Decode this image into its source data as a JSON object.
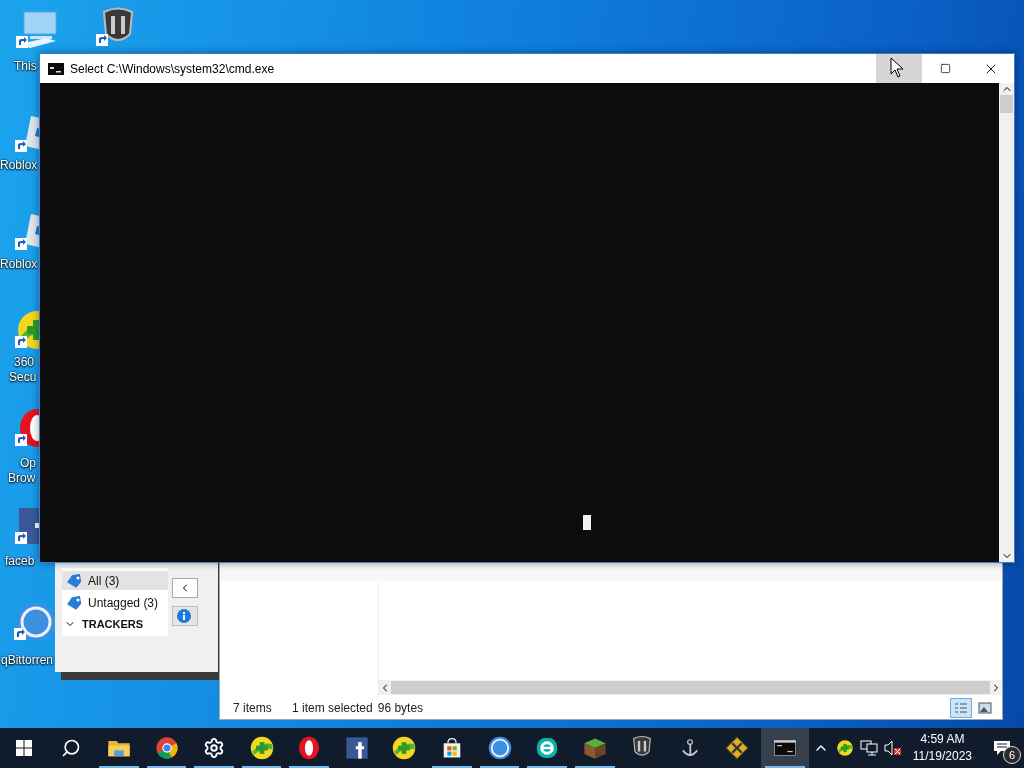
{
  "desktop_icons": [
    {
      "kind": "pc",
      "label_lines": [
        "This"
      ]
    },
    {
      "kind": "tanks"
    },
    {
      "kind": "roblox",
      "label_lines": [
        "Roblox"
      ]
    },
    {
      "kind": "roblox",
      "label_lines": [
        "Roblox"
      ]
    },
    {
      "kind": "security360",
      "label_lines": [
        "360",
        "Secu"
      ]
    },
    {
      "kind": "opera",
      "label_lines": [
        "Op",
        "Brow"
      ]
    },
    {
      "kind": "facebook",
      "label_lines": [
        "faceb"
      ]
    },
    {
      "kind": "qbittorrent",
      "label_lines": [
        "qBittorren"
      ]
    }
  ],
  "qbittorrent_window": {
    "tags": [
      {
        "label": "All (3)",
        "selected": true
      },
      {
        "label": "Untagged (3)",
        "selected": false
      }
    ],
    "section": "TRACKERS"
  },
  "explorer_window": {
    "item_count": "7 items",
    "selection": "1 item selected",
    "size": "96 bytes",
    "views": [
      {
        "kind": "details",
        "selected": true
      },
      {
        "kind": "large",
        "selected": false
      }
    ]
  },
  "cmd_window": {
    "title": "Select C:\\Windows\\system32\\cmd.exe",
    "minimize_hovered": true
  },
  "taskbar": {
    "apps": [
      {
        "kind": "explorer",
        "running": true,
        "active": false
      },
      {
        "kind": "chrome",
        "running": true,
        "active": false
      },
      {
        "kind": "settings",
        "running": true,
        "active": false
      },
      {
        "kind": "security360",
        "running": true,
        "active": false
      },
      {
        "kind": "opera",
        "running": true,
        "active": false
      },
      {
        "kind": "facebook",
        "running": false,
        "active": false
      },
      {
        "kind": "security360",
        "running": false,
        "active": false
      },
      {
        "kind": "store",
        "running": true,
        "active": false
      },
      {
        "kind": "qbittorrent",
        "running": true,
        "active": false
      },
      {
        "kind": "eset",
        "running": true,
        "active": false
      },
      {
        "kind": "minecraft",
        "running": true,
        "active": false
      },
      {
        "kind": "tanks",
        "running": false,
        "active": false
      },
      {
        "kind": "warships",
        "running": false,
        "active": false
      },
      {
        "kind": "game",
        "running": false,
        "active": false
      },
      {
        "kind": "cmd",
        "running": true,
        "active": true
      }
    ],
    "tray": [
      {
        "kind": "chevron"
      },
      {
        "kind": "security360"
      },
      {
        "kind": "network"
      },
      {
        "kind": "volume_muted"
      }
    ],
    "time": "4:59 AM",
    "date": "11/19/2023",
    "notifications": "6"
  }
}
